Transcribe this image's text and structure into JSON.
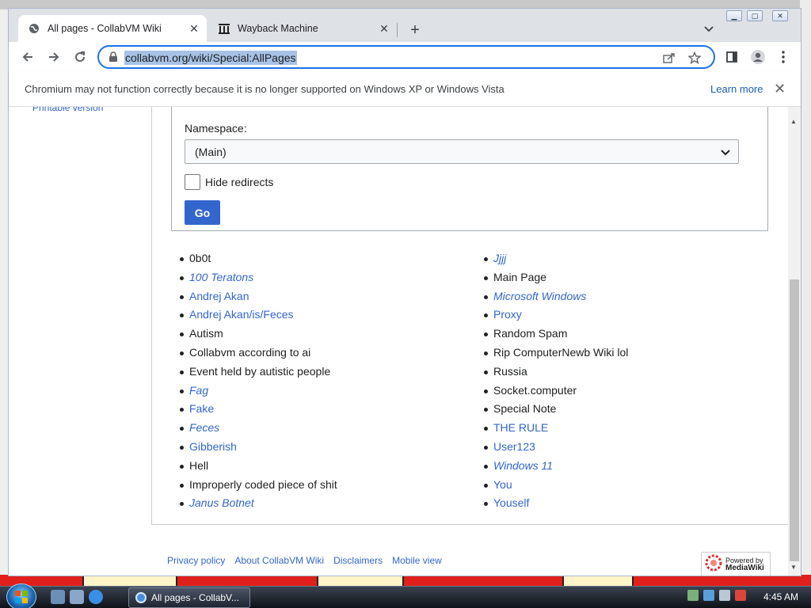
{
  "browser": {
    "tabs": [
      {
        "title": "All pages - CollabVM Wiki",
        "active": true
      },
      {
        "title": "Wayback Machine",
        "active": false
      }
    ],
    "url": "collabvm.org/wiki/Special:AllPages",
    "infobar": {
      "message": "Chromium may not function correctly because it is no longer supported on Windows XP or Windows Vista",
      "link": "Learn more"
    }
  },
  "sidebar": {
    "link": "Printable version"
  },
  "form": {
    "namespace_label": "Namespace:",
    "namespace_value": "(Main)",
    "hide_redirects_label": "Hide redirects",
    "go_label": "Go"
  },
  "pages_left": [
    {
      "text": "0b0t",
      "style": "dark"
    },
    {
      "text": "100 Teratons",
      "style": "blue italic"
    },
    {
      "text": "Andrej Akan",
      "style": "blue"
    },
    {
      "text": "Andrej Akan/is/Feces",
      "style": "blue"
    },
    {
      "text": "Autism",
      "style": "dark"
    },
    {
      "text": "Collabvm according to ai",
      "style": "dark"
    },
    {
      "text": "Event held by autistic people",
      "style": "dark"
    },
    {
      "text": "Fag",
      "style": "blue italic"
    },
    {
      "text": "Fake",
      "style": "blue"
    },
    {
      "text": "Feces",
      "style": "blue italic"
    },
    {
      "text": "Gibberish",
      "style": "blue"
    },
    {
      "text": "Hell",
      "style": "dark"
    },
    {
      "text": "Improperly coded piece of shit",
      "style": "dark"
    },
    {
      "text": "Janus Botnet",
      "style": "blue italic"
    }
  ],
  "pages_right": [
    {
      "text": "Jjjj",
      "style": "blue italic"
    },
    {
      "text": "Main Page",
      "style": "dark"
    },
    {
      "text": "Microsoft Windows",
      "style": "blue italic"
    },
    {
      "text": "Proxy",
      "style": "blue"
    },
    {
      "text": "Random Spam",
      "style": "dark"
    },
    {
      "text": "Rip ComputerNewb Wiki lol",
      "style": "dark"
    },
    {
      "text": "Russia",
      "style": "dark"
    },
    {
      "text": "Socket.computer",
      "style": "dark"
    },
    {
      "text": "Special Note",
      "style": "dark"
    },
    {
      "text": "THE RULE",
      "style": "blue"
    },
    {
      "text": "User123",
      "style": "blue"
    },
    {
      "text": "Windows 11",
      "style": "blue italic"
    },
    {
      "text": "You",
      "style": "blue"
    },
    {
      "text": "Youself",
      "style": "blue"
    }
  ],
  "footer": {
    "links": [
      "Privacy policy",
      "About CollabVM Wiki",
      "Disclaimers",
      "Mobile view"
    ],
    "badge_line1": "Powered by",
    "badge_line2": "MediaWiki"
  },
  "taskbar": {
    "task_label": "All pages - CollabV...",
    "clock": "4:45 AM"
  },
  "colors": {
    "accent": "#3366cc",
    "omnibox_border": "#1a73e8"
  }
}
